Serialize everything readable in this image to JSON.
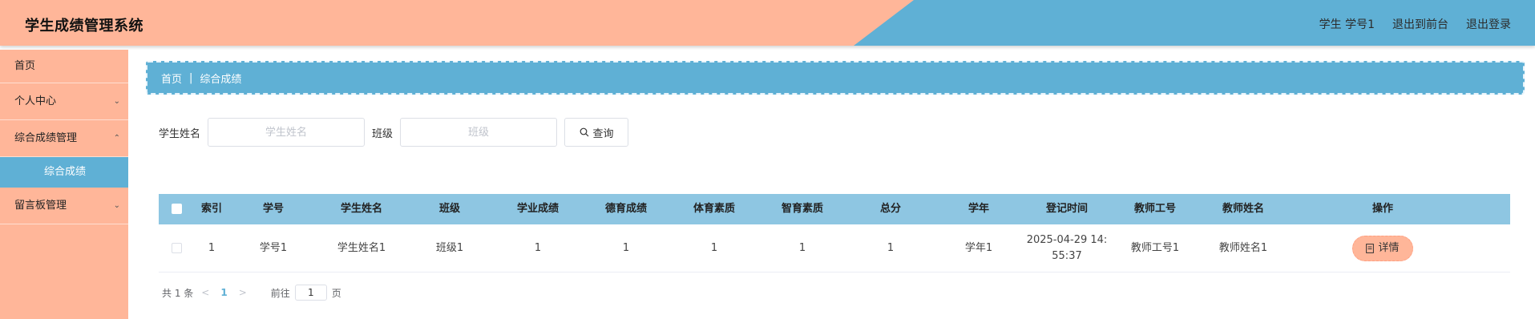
{
  "header": {
    "title": "学生成绩管理系统",
    "user": "学生 学号1",
    "to_front": "退出到前台",
    "logout": "退出登录"
  },
  "sidebar": {
    "items": [
      {
        "label": "首页"
      },
      {
        "label": "个人中心"
      },
      {
        "label": "综合成绩管理"
      },
      {
        "label": "综合成绩"
      },
      {
        "label": "留言板管理"
      }
    ]
  },
  "breadcrumb": {
    "home": "首页",
    "sep": "|",
    "current": "综合成绩"
  },
  "search": {
    "name_label": "学生姓名",
    "name_placeholder": "学生姓名",
    "class_label": "班级",
    "class_placeholder": "班级",
    "button": "查询"
  },
  "table": {
    "headers": [
      "索引",
      "学号",
      "学生姓名",
      "班级",
      "学业成绩",
      "德育成绩",
      "体育素质",
      "智育素质",
      "总分",
      "学年",
      "登记时间",
      "教师工号",
      "教师姓名",
      "操作"
    ],
    "rows": [
      {
        "index": "1",
        "student_no": "学号1",
        "student_name": "学生姓名1",
        "class": "班级1",
        "academic": "1",
        "moral": "1",
        "sports": "1",
        "intellect": "1",
        "total": "1",
        "year": "学年1",
        "time_line1": "2025-04-29 14:",
        "time_line2": "55:37",
        "teacher_no": "教师工号1",
        "teacher_name": "教师姓名1",
        "action": "详情"
      }
    ]
  },
  "pagination": {
    "total": "共 1 条",
    "prev": "<",
    "page": "1",
    "next": ">",
    "goto_label": "前往",
    "goto_value": "1",
    "page_unit": "页"
  },
  "colors": {
    "accent_orange": "#ffb699",
    "accent_blue": "#5fb0d5",
    "table_header": "#8ec6e2"
  }
}
